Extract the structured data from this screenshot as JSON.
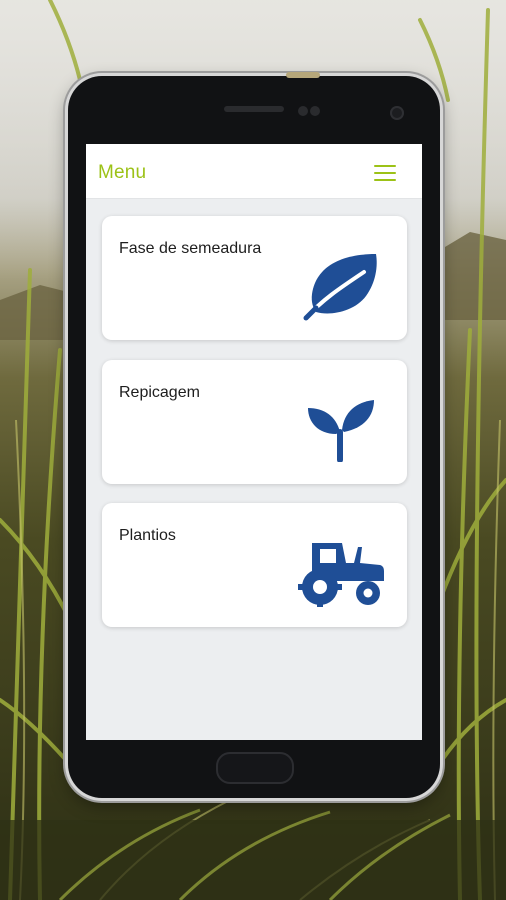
{
  "app": {
    "title": "Menu"
  },
  "menu_items": [
    {
      "label": "Fase de semeadura",
      "icon": "leaf-icon"
    },
    {
      "label": "Repicagem",
      "icon": "sprout-icon"
    },
    {
      "label": "Plantios",
      "icon": "tractor-icon"
    }
  ],
  "colors": {
    "accent": "#9cc217",
    "icon": "#1f4e96",
    "screen_bg": "#eceef0"
  }
}
